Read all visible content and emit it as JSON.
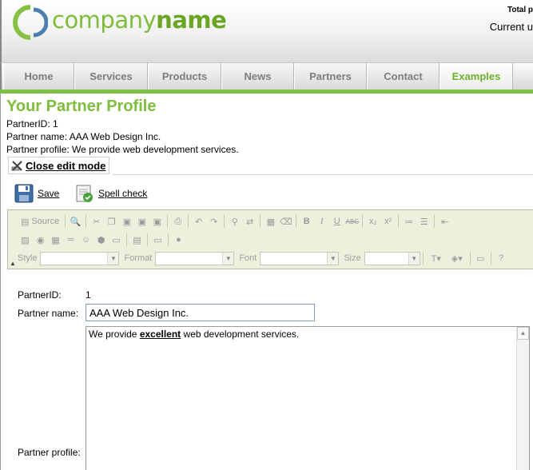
{
  "header": {
    "logo_word_1": "company",
    "logo_word_2": "name",
    "total_label": "Total p",
    "current_label": "Current u"
  },
  "nav": {
    "items": [
      {
        "label": "Home"
      },
      {
        "label": "Services"
      },
      {
        "label": "Products"
      },
      {
        "label": "News"
      },
      {
        "label": "Partners"
      },
      {
        "label": "Contact"
      },
      {
        "label": "Examples",
        "active": true
      }
    ]
  },
  "page": {
    "title": "Your Partner Profile",
    "info": {
      "partner_id_line": "PartnerID: 1",
      "partner_name_line": "Partner name: AAA Web Design Inc.",
      "partner_profile_line": "Partner profile: We provide web development services."
    },
    "close_edit_label": "Close edit mode"
  },
  "actions": {
    "save_label": "Save",
    "spellcheck_label": "Spell check"
  },
  "editor_toolbar": {
    "source_label": "Source",
    "style_label": "Style",
    "format_label": "Format",
    "font_label": "Font",
    "size_label": "Size"
  },
  "form": {
    "partner_id_label": "PartnerID:",
    "partner_id_value": "1",
    "partner_name_label": "Partner name:",
    "partner_name_value": "AAA Web Design Inc.",
    "partner_profile_label": "Partner profile:",
    "profile_text_before": "We provide ",
    "profile_text_bold": "excellent",
    "profile_text_after": " web development services."
  },
  "colors": {
    "brand_green": "#7fbd3c",
    "nav_underline": "#7fc041",
    "toolbar_bg": "#efefde"
  }
}
